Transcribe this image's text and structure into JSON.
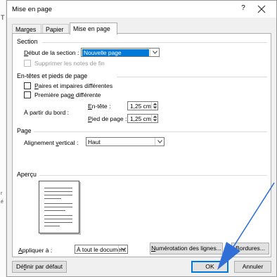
{
  "background_doc": {
    "fragments": [
      "T",
      "r",
      "é"
    ]
  },
  "dialog": {
    "title": "Mise en page",
    "help_glyph": "?",
    "tabs": [
      {
        "label": "Marges"
      },
      {
        "label": "Papier"
      },
      {
        "label": "Mise en page"
      }
    ],
    "section": {
      "heading": "Section",
      "start_label_ul": "D",
      "start_label_rest": "ébut de la section :",
      "start_value": "Nouvelle page",
      "suppress_endnotes_label": "Supprimer les notes de fin"
    },
    "headers_footers": {
      "heading": "En-têtes et pieds de page",
      "odd_even_ul": "P",
      "odd_even_rest": "aires et impaires différentes",
      "first_page_pre": "Première pag",
      "first_page_ul": "e",
      "first_page_post": " différente",
      "from_edge_label": "À partir du bord :",
      "header_label_ul": "E",
      "header_label_rest": "n-tête :",
      "header_value": "1,25 cm",
      "footer_label_ul": "P",
      "footer_label_rest": "ied de page :",
      "footer_value": "1,25 cm"
    },
    "page": {
      "heading": "Page",
      "valign_pre": "Alignement ",
      "valign_ul": "v",
      "valign_post": "ertical :",
      "valign_value": "Haut"
    },
    "preview": {
      "heading": "Aperçu"
    },
    "apply": {
      "label_ul": "A",
      "label_rest": "ppliquer à :",
      "value": "À tout le document"
    },
    "buttons": {
      "line_numbers_ul": "N",
      "line_numbers_rest": "umérotation des lignes...",
      "borders_ul": "B",
      "borders_rest": "ordures...",
      "set_default_pre": "Dé",
      "set_default_ul": "f",
      "set_default_post": "inir par défaut",
      "ok": "OK",
      "cancel": "Annuler"
    }
  },
  "colors": {
    "selection": "#0078d7",
    "annotation_arrow": "#2f6fd6"
  }
}
